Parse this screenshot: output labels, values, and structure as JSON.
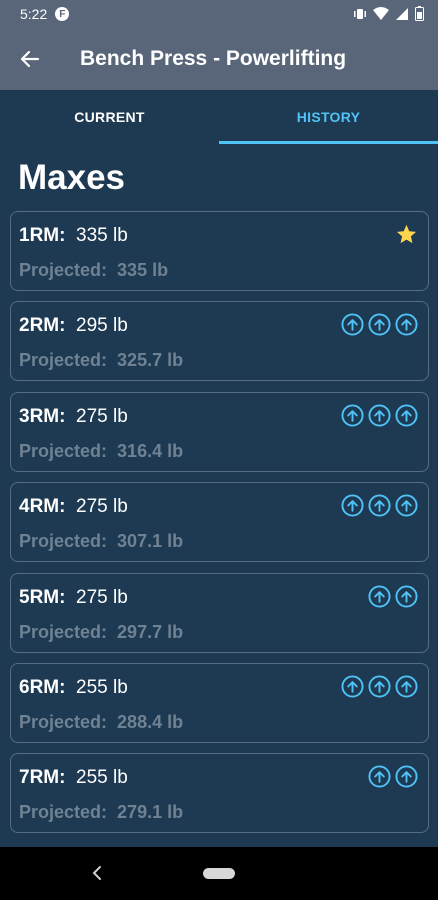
{
  "status_bar": {
    "time": "5:22",
    "app_icon": "F"
  },
  "app_bar": {
    "title": "Bench Press - Powerlifting",
    "back_icon": "arrow-left-icon"
  },
  "tabs": [
    {
      "label": "CURRENT",
      "active": false
    },
    {
      "label": "HISTORY",
      "active": true
    }
  ],
  "section_title": "Maxes",
  "projected_label": "Projected:",
  "colors": {
    "accent": "#4fc3f7",
    "star": "#ffd54f",
    "background": "#1e3a52",
    "app_bar": "#596579"
  },
  "maxes": [
    {
      "label": "1RM:",
      "weight": "335 lb",
      "projected": "335 lb",
      "badge": "star",
      "arrows": 0
    },
    {
      "label": "2RM:",
      "weight": "295 lb",
      "projected": "325.7 lb",
      "badge": "arrows",
      "arrows": 3
    },
    {
      "label": "3RM:",
      "weight": "275 lb",
      "projected": "316.4 lb",
      "badge": "arrows",
      "arrows": 3
    },
    {
      "label": "4RM:",
      "weight": "275 lb",
      "projected": "307.1 lb",
      "badge": "arrows",
      "arrows": 3
    },
    {
      "label": "5RM:",
      "weight": "275 lb",
      "projected": "297.7 lb",
      "badge": "arrows",
      "arrows": 2
    },
    {
      "label": "6RM:",
      "weight": "255 lb",
      "projected": "288.4 lb",
      "badge": "arrows",
      "arrows": 3
    },
    {
      "label": "7RM:",
      "weight": "255 lb",
      "projected": "279.1 lb",
      "badge": "arrows",
      "arrows": 2
    }
  ]
}
